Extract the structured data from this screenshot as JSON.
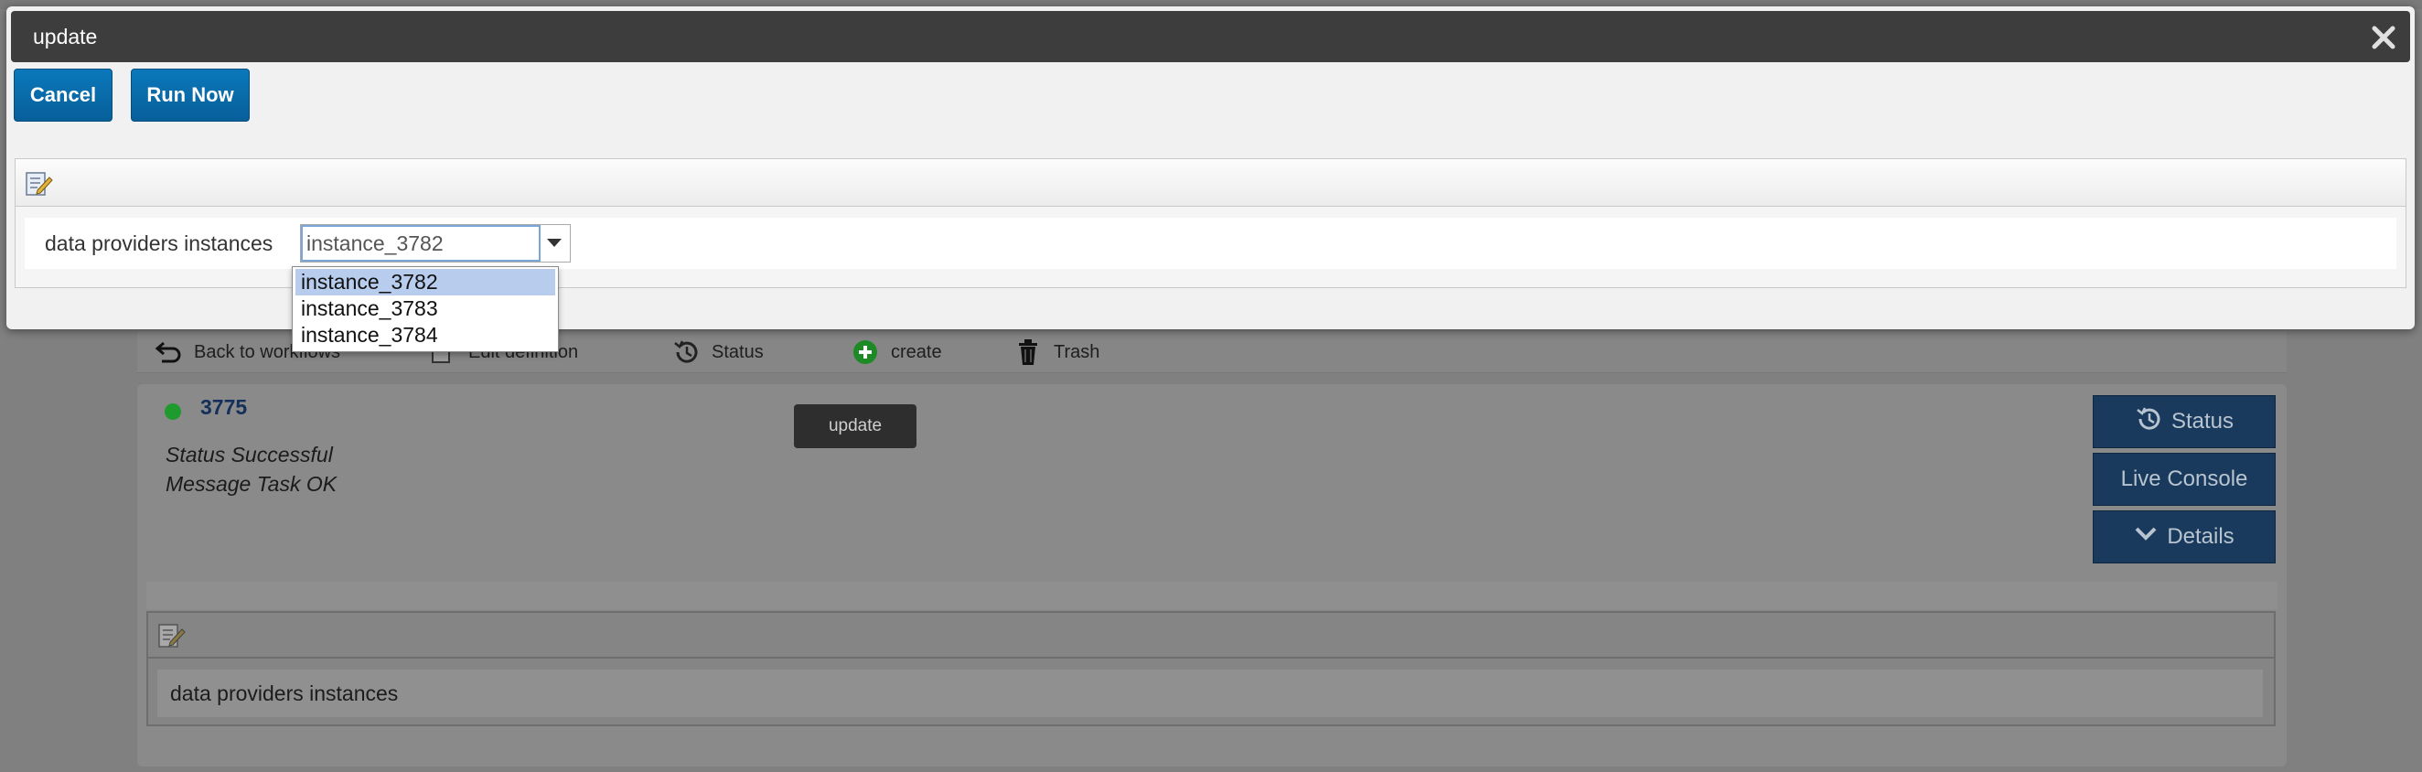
{
  "modal": {
    "title": "update",
    "cancel_label": "Cancel",
    "run_now_label": "Run Now",
    "field_label": "data providers instances",
    "field_value": "instance_3782",
    "dropdown_options": [
      "instance_3782",
      "instance_3783",
      "instance_3784"
    ],
    "selected_index": 0
  },
  "toolbar": {
    "back_label": "Back to workflows",
    "edit_label": "Edit definition",
    "status_label": "Status",
    "create_label": "create",
    "trash_label": "Trash"
  },
  "job": {
    "id": "3775",
    "status_text": "Status Successful",
    "message_text": "Message Task OK",
    "update_label": "update",
    "status_button": "Status",
    "live_console_button": "Live Console",
    "details_button": "Details",
    "status_color": "#1e9a2e"
  },
  "bg_form": {
    "field_label": "data providers instances"
  },
  "colors": {
    "primary_button": "#0b78bb",
    "modal_title_bar": "#3d3d3d",
    "side_button": "#193a5c",
    "dropdown_highlight": "#b8cdee"
  }
}
